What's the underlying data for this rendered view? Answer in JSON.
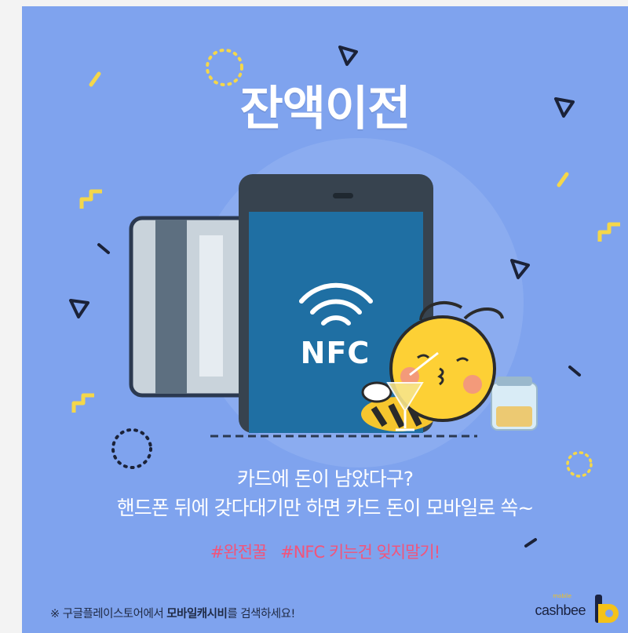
{
  "title": "잔액이전",
  "nfc_label": "NFC",
  "message": {
    "line1": "카드에 돈이 남았다구?",
    "line2": "핸드폰 뒤에 갖다대기만 하면 카드 돈이 모바일로 쏙~"
  },
  "hashtags": [
    "#완전꿀",
    "#NFC 키는건 잊지말기!"
  ],
  "footer": {
    "prefix": "※ 구글플레이스토어에서 ",
    "app_name": "모바일캐시비",
    "suffix": "를 검색하세요!"
  },
  "brand": {
    "tag": "mobile",
    "name": "cashbee"
  },
  "colors": {
    "background": "#7fa3ee",
    "accent_yellow": "#f4c21a",
    "hashtag_pink": "#f2547a"
  }
}
